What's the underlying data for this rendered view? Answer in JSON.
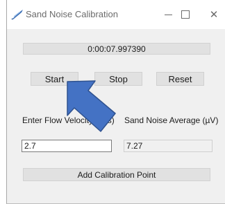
{
  "window": {
    "title": "Sand Noise Calibration"
  },
  "timer": {
    "value": "0:00:07.997390"
  },
  "buttons": {
    "start": "Start",
    "stop": "Stop",
    "reset": "Reset",
    "add_point": "Add Calibration Point"
  },
  "labels": {
    "flow_velocity": "Enter Flow Velocity (m/s)",
    "sand_noise": "Sand Noise Average (µV)"
  },
  "inputs": {
    "flow_velocity_value": "2.7",
    "sand_noise_value": "7.27"
  },
  "annotation": {
    "arrow_color": "#4472c4",
    "arrow_stroke": "#2f528f"
  },
  "icons": {
    "app": "feather-icon",
    "minimize": "minimize-icon",
    "maximize": "maximize-icon",
    "close": "close-icon"
  }
}
